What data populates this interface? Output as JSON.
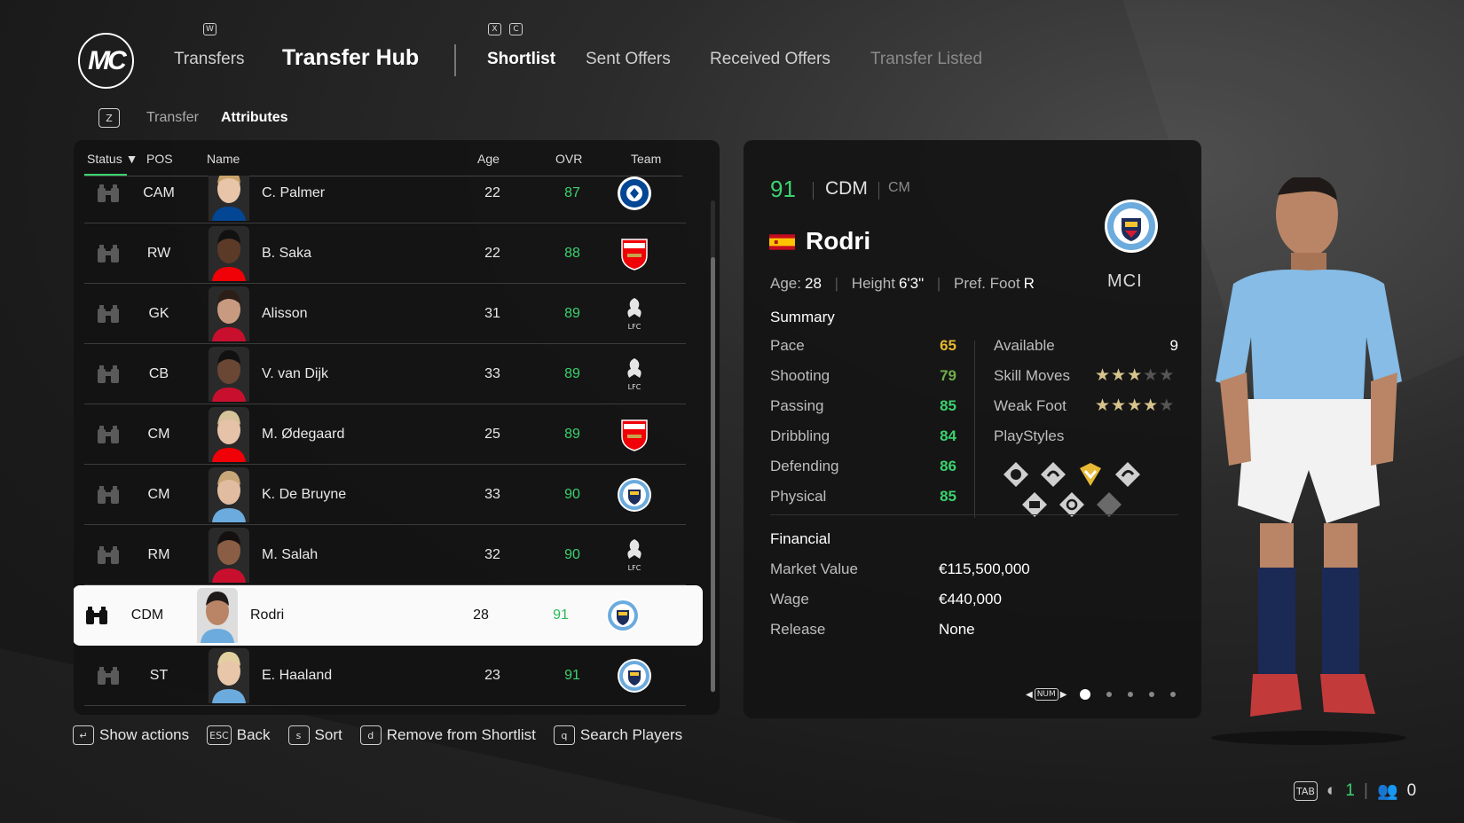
{
  "nav": {
    "logo": "MC",
    "transfers_key": "W",
    "transfers": "Transfers",
    "hub": "Transfer Hub",
    "shortlist_keys": [
      "X",
      "C"
    ],
    "shortlist": "Shortlist",
    "sent_offers": "Sent Offers",
    "received_offers": "Received Offers",
    "transfer_listed": "Transfer Listed"
  },
  "breadcrumb": {
    "key": "Z",
    "transfer": "Transfer",
    "attributes": "Attributes"
  },
  "table": {
    "headers": {
      "status": "Status",
      "pos": "POS",
      "name": "Name",
      "age": "Age",
      "ovr": "OVR",
      "team": "Team"
    },
    "rows": [
      {
        "pos": "CAM",
        "name": "C. Palmer",
        "age": "22",
        "ovr": "87",
        "team": "chelsea"
      },
      {
        "pos": "RW",
        "name": "B. Saka",
        "age": "22",
        "ovr": "88",
        "team": "arsenal"
      },
      {
        "pos": "GK",
        "name": "Alisson",
        "age": "31",
        "ovr": "89",
        "team": "liverpool"
      },
      {
        "pos": "CB",
        "name": "V. van Dijk",
        "age": "33",
        "ovr": "89",
        "team": "liverpool"
      },
      {
        "pos": "CM",
        "name": "M. Ødegaard",
        "age": "25",
        "ovr": "89",
        "team": "arsenal"
      },
      {
        "pos": "CM",
        "name": "K. De Bruyne",
        "age": "33",
        "ovr": "90",
        "team": "mancity"
      },
      {
        "pos": "RM",
        "name": "M. Salah",
        "age": "32",
        "ovr": "90",
        "team": "liverpool"
      },
      {
        "pos": "CDM",
        "name": "Rodri",
        "age": "28",
        "ovr": "91",
        "team": "mancity"
      },
      {
        "pos": "ST",
        "name": "E. Haaland",
        "age": "23",
        "ovr": "91",
        "team": "mancity"
      }
    ],
    "selected_index": 7
  },
  "footer": {
    "show_actions": "Show actions",
    "back_key": "ESC",
    "back": "Back",
    "sort_key": "s",
    "sort": "Sort",
    "remove_key": "d",
    "remove": "Remove from Shortlist",
    "search_key": "q",
    "search": "Search Players"
  },
  "player": {
    "ovr": "91",
    "position": "CDM",
    "alt_position": "CM",
    "name": "Rodri",
    "age_label": "Age:",
    "age": "28",
    "height_label": "Height",
    "height": "6'3\"",
    "foot_label": "Pref. Foot",
    "foot": "R",
    "club_abbr": "MCI",
    "summary_title": "Summary",
    "stats": [
      {
        "label": "Pace",
        "value": "65",
        "color": "#e6b930"
      },
      {
        "label": "Shooting",
        "value": "79",
        "color": "#6fb04a"
      },
      {
        "label": "Passing",
        "value": "85",
        "color": "#3bd26e"
      },
      {
        "label": "Dribbling",
        "value": "84",
        "color": "#3bd26e"
      },
      {
        "label": "Defending",
        "value": "86",
        "color": "#3bd26e"
      },
      {
        "label": "Physical",
        "value": "85",
        "color": "#3bd26e"
      }
    ],
    "available_label": "Available",
    "available": "9",
    "skill_moves_label": "Skill Moves",
    "skill_moves": 3,
    "weak_foot_label": "Weak Foot",
    "weak_foot": 4,
    "playstyles_label": "PlayStyles",
    "financial_title": "Financial",
    "market_value_label": "Market Value",
    "market_value": "€115,500,000",
    "wage_label": "Wage",
    "wage": "€440,000",
    "release_label": "Release",
    "release": "None",
    "pager_key": "NUM",
    "pages": 5,
    "current_page": 1
  },
  "status_bar": {
    "tab_key": "TAB",
    "count_a": "1",
    "count_b": "0"
  },
  "colors": {
    "accent_green": "#3bd26e",
    "gold": "#d8c48c"
  }
}
